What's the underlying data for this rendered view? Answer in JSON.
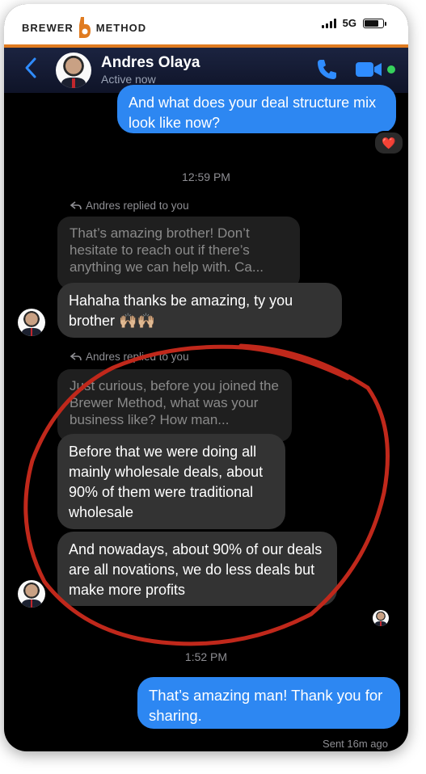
{
  "brand": {
    "left": "BREWER",
    "right": "METHOD"
  },
  "status_bar": {
    "network": "5G",
    "battery_level": 0.8,
    "signal_bars": 4
  },
  "header": {
    "back_icon": "chevron-left-icon",
    "contact_name": "Andres Olaya",
    "contact_status": "Active now",
    "phone_icon": "phone-icon",
    "video_icon": "video-camera-icon",
    "online_color": "#36d15c"
  },
  "messages": {
    "m1": {
      "sender": "me",
      "text": "And what does your deal structure mix look like now?",
      "reaction": "❤️"
    },
    "time1": "12:59 PM",
    "reply1_note": "Andres replied to you",
    "quote1": "That’s amazing brother! Don’t hesitate to reach out if there’s anything we can help with. Ca...",
    "m2": {
      "sender": "Andres",
      "text": "Hahaha thanks be amazing, ty you brother 🙌🏼🙌🏼"
    },
    "reply2_note": "Andres replied to you",
    "quote2": "Just curious, before you joined the Brewer Method, what was your business like? How man...",
    "m3": {
      "sender": "Andres",
      "text": "Before that we were doing all mainly wholesale deals, about 90% of them were traditional wholesale"
    },
    "m4": {
      "sender": "Andres",
      "text": "And nowadays, about 90% of our deals are all novations, we do less deals but make more profits"
    },
    "time2": "1:52 PM",
    "m5": {
      "sender": "me",
      "text": "That’s amazing man! Thank you for sharing."
    },
    "sent_note": "Sent 16m ago"
  },
  "colors": {
    "outgoing_bubble": "#2d87f2",
    "incoming_bubble": "#333333",
    "accent_orange": "#e07b20",
    "annotation_red": "#c0281b"
  }
}
